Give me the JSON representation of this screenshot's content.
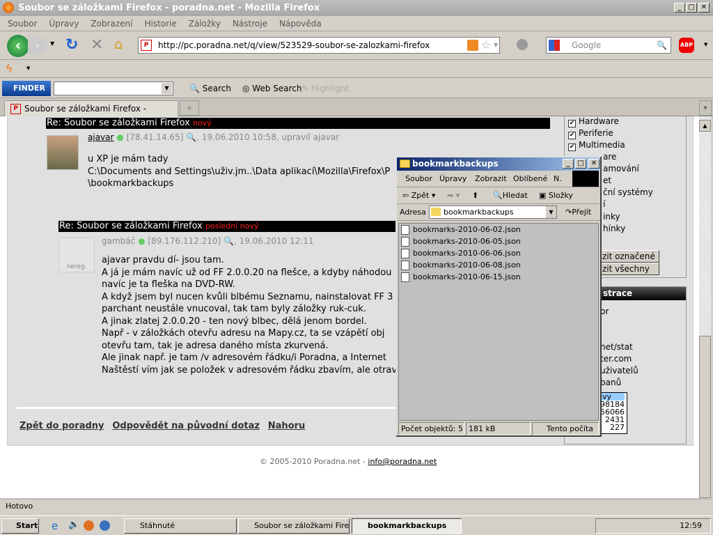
{
  "window": {
    "title": "Soubor se záložkami Firefox - poradna.net - Mozilla Firefox",
    "min": "_",
    "max": "□",
    "close": "✕"
  },
  "menu": [
    "Soubor",
    "Úpravy",
    "Zobrazení",
    "Historie",
    "Záložky",
    "Nástroje",
    "Nápověda"
  ],
  "nav": {
    "url": "http://pc.poradna.net/q/view/523529-soubor-se-zalozkami-firefox",
    "search_placeholder": "Google",
    "abp": "ABP"
  },
  "finder": {
    "logo": "FINDER",
    "search": "Search",
    "web_search": "Web Search",
    "highlight": "Highlight"
  },
  "tab": {
    "label": "Soubor se záložkami Firefox - porad...",
    "new": "+"
  },
  "posts": [
    {
      "title": "Re: Soubor se záložkami Firefox",
      "badge": "nový",
      "author": "ajavar",
      "meta": "[78.41.14.65] 🔍, 19.06.2010 10:58, upravil ajavar",
      "lines": [
        "u XP je mám tady",
        "C:\\Documents and Settings\\uživ.jm..\\Data aplikací\\Mozilla\\Firefox\\P",
        "\\bookmarkbackups"
      ]
    },
    {
      "title": "Re: Soubor se záložkami Firefox",
      "badge": "poslední nový",
      "author": "gambáč",
      "avatar_label": "nereg.",
      "meta": "[89.176.112.210] 🔍, 19.06.2010 12:11",
      "lines": [
        "ajavar pravdu dí- jsou tam.",
        "A já je mám navíc už od FF 2.0.0.20 na flešce, a kdyby náhodou",
        "navíc je ta fleška na DVD-RW.",
        "A když jsem byl nucen kvůli blbému Seznamu, nainstalovat FF 3",
        "parchant neustále vnucoval, tak tam byly záložky ruk-cuk.",
        "A jinak zlatej 2.0.0.20 - ten nový blbec, dělá jenom bordel.",
        "Např - v záložkách otevřu adresu na Mapy.cz, ta se vzápětí obj",
        "otevřu tam, tak je adresa daného místa zkurvená.",
        "Ale jinak např. je tam /v adresovém řádku/i Poradna, a Internet",
        "Naštěstí vím jak se položek v adresovém řádku zbavím, ale otrav"
      ]
    }
  ],
  "footer_links": [
    "Zpět do poradny",
    "Odpovědět na původní dotaz",
    "Nahoru"
  ],
  "copyright": "© 2005-2010 Poradna.net - ",
  "email": "info@poradna.net",
  "sidebar": {
    "categories": [
      "Hardware",
      "Periferie",
      "Multimedia",
      "are",
      "amování",
      "et",
      "ční systémy",
      "í",
      "inky",
      "hínky"
    ],
    "btn1": "zit označené",
    "btn2": "zit všechny",
    "admin_title": "strace",
    "admin_items": [
      "or",
      "net/stat",
      "ter.com",
      "uživatelů",
      "banů"
    ],
    "stats_head": "vy",
    "stats": [
      "98184",
      "56066",
      "2431",
      "227"
    ]
  },
  "explorer": {
    "title": "bookmarkbackups",
    "menu": [
      "Soubor",
      "Úpravy",
      "Zobrazit",
      "Oblíbené",
      "N."
    ],
    "back": "Zpět",
    "search": "Hledat",
    "folders": "Složky",
    "address_label": "Adresa",
    "address": "bookmarkbackups",
    "go": "Přejít",
    "files": [
      "bookmarks-2010-06-02.json",
      "bookmarks-2010-06-05.json",
      "bookmarks-2010-06-06.json",
      "bookmarks-2010-06-08.json",
      "bookmarks-2010-06-15.json"
    ],
    "count": "Počet objektů: 5",
    "size": "181 kB",
    "location": "Tento počíta"
  },
  "status": "Hotovo",
  "taskbar": {
    "start": "Start",
    "items": [
      "Stáhnuté",
      "Soubor se záložkami Firef...",
      "bookmarkbackups"
    ],
    "clock": "12:59"
  }
}
